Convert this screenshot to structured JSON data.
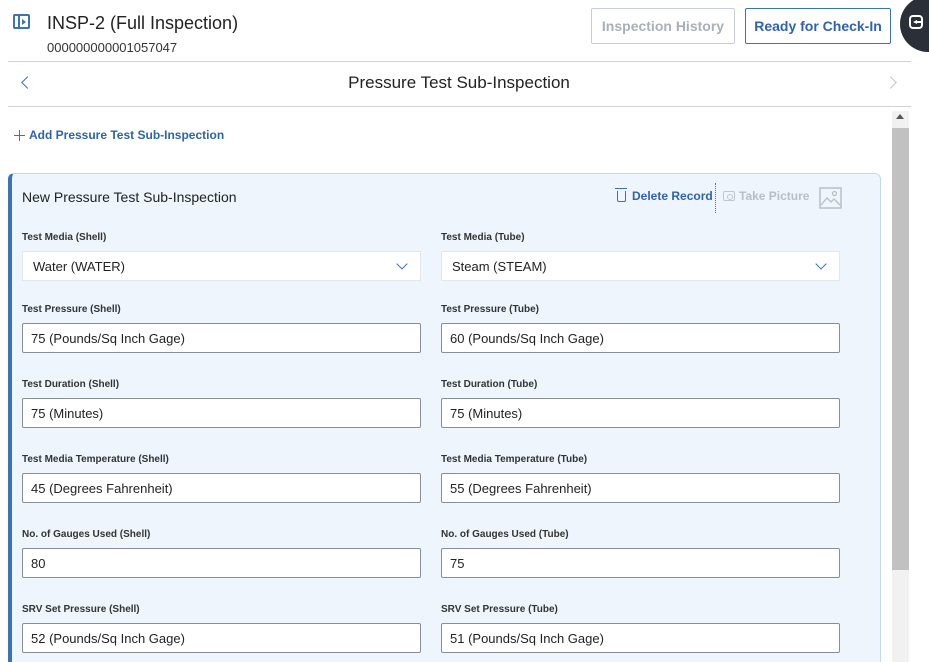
{
  "header": {
    "title": "INSP-2 (Full Inspection)",
    "subtitle": "000000000001057047",
    "history_label": "Inspection History",
    "checkin_label": "Ready for Check-In"
  },
  "nav": {
    "title": "Pressure Test Sub-Inspection"
  },
  "add_link": {
    "label": "Add Pressure Test Sub-Inspection"
  },
  "card": {
    "title": "New Pressure Test Sub-Inspection",
    "delete_label": "Delete Record",
    "take_picture_label": "Take Picture"
  },
  "fields": {
    "media_shell": {
      "label": "Test Media (Shell)",
      "value": "Water (WATER)"
    },
    "media_tube": {
      "label": "Test Media (Tube)",
      "value": "Steam (STEAM)"
    },
    "pressure_shell": {
      "label": "Test Pressure (Shell)",
      "value": "75 (Pounds/Sq Inch Gage)"
    },
    "pressure_tube": {
      "label": "Test Pressure (Tube)",
      "value": "60 (Pounds/Sq Inch Gage)"
    },
    "duration_shell": {
      "label": "Test Duration (Shell)",
      "value": "75 (Minutes)"
    },
    "duration_tube": {
      "label": "Test Duration (Tube)",
      "value": "75 (Minutes)"
    },
    "temp_shell": {
      "label": "Test Media Temperature (Shell)",
      "value": "45 (Degrees Fahrenheit)"
    },
    "temp_tube": {
      "label": "Test Media Temperature (Tube)",
      "value": "55 (Degrees Fahrenheit)"
    },
    "gauges_shell": {
      "label": "No. of Gauges Used (Shell)",
      "value": "80"
    },
    "gauges_tube": {
      "label": "No. of Gauges Used (Tube)",
      "value": "75"
    },
    "srv_shell": {
      "label": "SRV Set Pressure (Shell)",
      "value": "52 (Pounds/Sq Inch Gage)"
    },
    "srv_tube": {
      "label": "SRV Set Pressure (Tube)",
      "value": "51 (Pounds/Sq Inch Gage)"
    }
  },
  "icons": {
    "panel_toggle": "sidebar-panel-icon",
    "exit": "exit-icon",
    "nav_prev": "chevron-left-icon",
    "nav_next": "chevron-right-icon",
    "add": "plus-icon",
    "delete": "trash-icon",
    "camera": "camera-icon",
    "image": "image-icon",
    "dropdown": "chevron-down-icon"
  },
  "colors": {
    "accent": "#3b73b9",
    "card_background": "#eef5fd",
    "disabled_text": "#a9b0ba"
  }
}
